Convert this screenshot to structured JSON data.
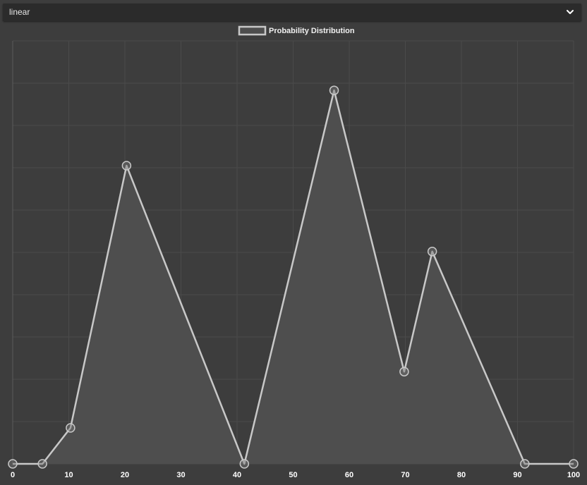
{
  "dropdown": {
    "selected": "linear",
    "icon": "chevron-down-icon"
  },
  "colors": {
    "background": "#3d3d3d",
    "line": "#c8c8c8",
    "fill": "#4e4e4e",
    "grid": "#4a4a4a"
  },
  "chart_data": {
    "type": "area",
    "title": "",
    "xlabel": "",
    "ylabel": "",
    "xlim": [
      0,
      100
    ],
    "ylim": [
      0,
      10
    ],
    "grid": true,
    "legend_position": "top-center",
    "x_ticks": [
      "0",
      "10",
      "20",
      "30",
      "40",
      "50",
      "60",
      "70",
      "80",
      "90",
      "100"
    ],
    "series": [
      {
        "name": "Probability Distribution",
        "points": [
          {
            "x": 0,
            "y": 0
          },
          {
            "x": 5.3,
            "y": 0
          },
          {
            "x": 10.3,
            "y": 0.85
          },
          {
            "x": 20.3,
            "y": 7.05
          },
          {
            "x": 41.3,
            "y": 0
          },
          {
            "x": 57.3,
            "y": 8.83
          },
          {
            "x": 69.8,
            "y": 2.18
          },
          {
            "x": 74.8,
            "y": 5.02
          },
          {
            "x": 91.3,
            "y": 0
          },
          {
            "x": 100,
            "y": 0
          }
        ]
      }
    ]
  }
}
